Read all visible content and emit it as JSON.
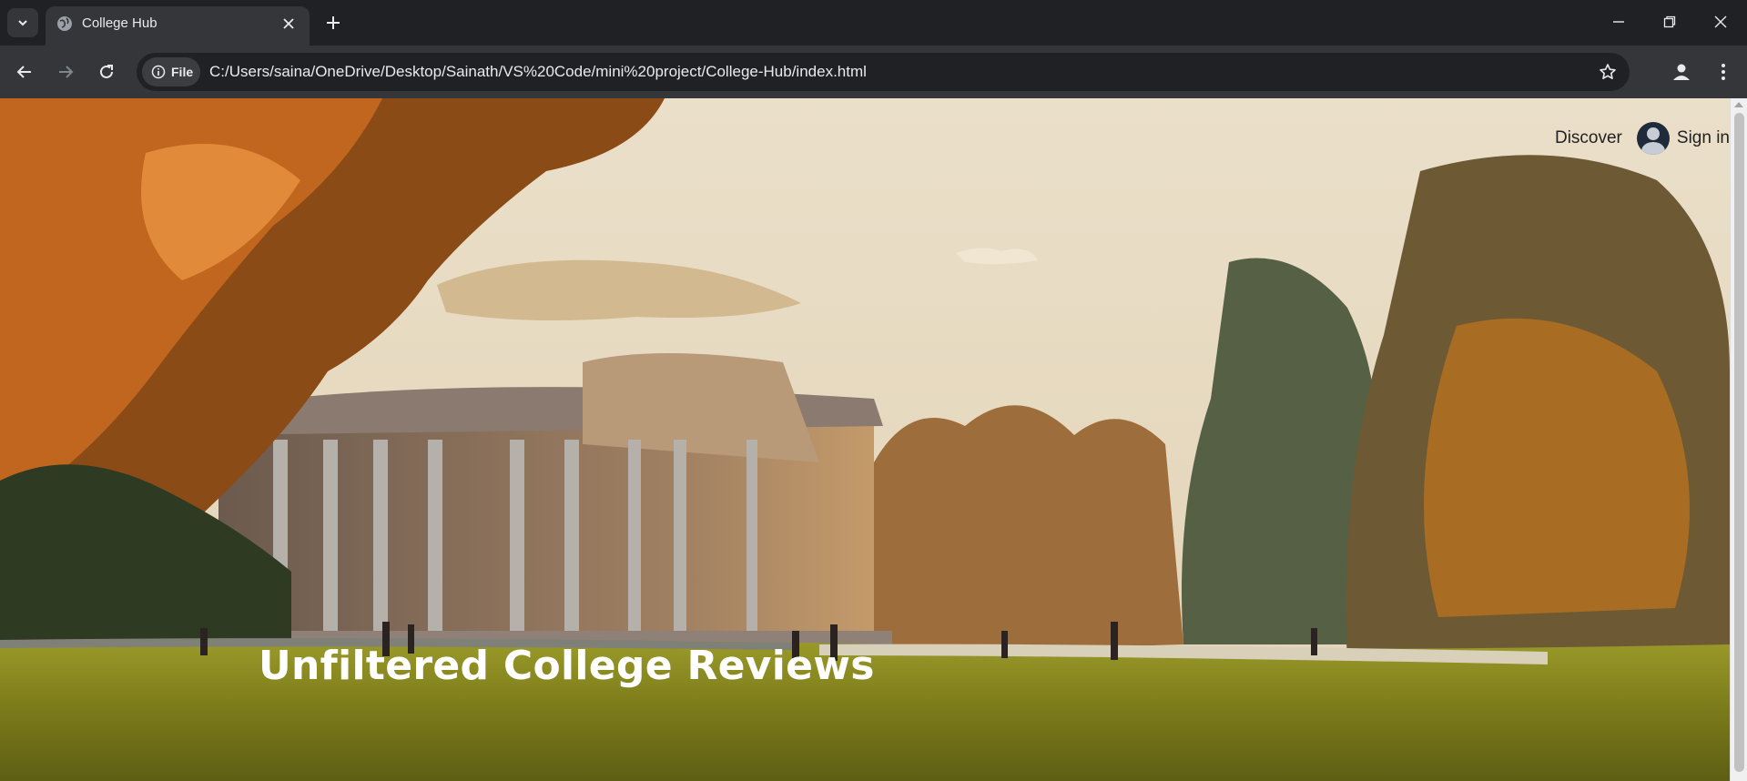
{
  "browser": {
    "tab": {
      "title": "College Hub"
    },
    "address": {
      "chip_label": "File",
      "url": "C:/Users/saina/OneDrive/Desktop/Sainath/VS%20Code/mini%20project/College-Hub/index.html"
    }
  },
  "site": {
    "nav": {
      "discover": "Discover",
      "signin": "Sign in"
    },
    "hero": {
      "title": "Unfiltered College Reviews"
    }
  },
  "colors": {
    "tabstrip": "#202124",
    "toolbar": "#35363a",
    "sky": "#e8dcc6",
    "grass": "#8a8a1e"
  }
}
